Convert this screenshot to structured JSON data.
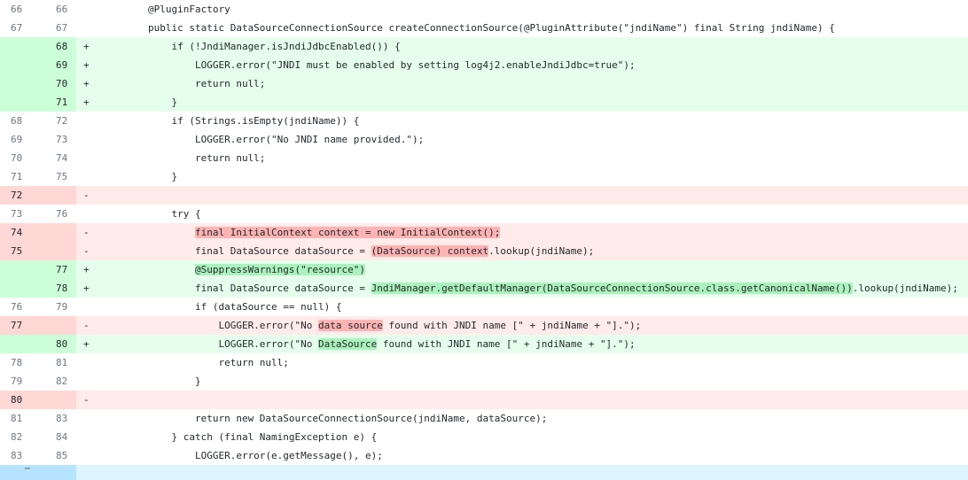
{
  "diff": {
    "rows": [
      {
        "type": "ctx",
        "old": "66",
        "new": "66",
        "sign": "",
        "code": "        @PluginFactory"
      },
      {
        "type": "ctx",
        "old": "67",
        "new": "67",
        "sign": "",
        "code": "        public static DataSourceConnectionSource createConnectionSource(@PluginAttribute(\"jndiName\") final String jndiName) {"
      },
      {
        "type": "add",
        "old": "",
        "new": "68",
        "sign": "+",
        "code": "            if (!JndiManager.isJndiJdbcEnabled()) {"
      },
      {
        "type": "add",
        "old": "",
        "new": "69",
        "sign": "+",
        "code": "                LOGGER.error(\"JNDI must be enabled by setting log4j2.enableJndiJdbc=true\");"
      },
      {
        "type": "add",
        "old": "",
        "new": "70",
        "sign": "+",
        "code": "                return null;"
      },
      {
        "type": "add",
        "old": "",
        "new": "71",
        "sign": "+",
        "code": "            }"
      },
      {
        "type": "ctx",
        "old": "68",
        "new": "72",
        "sign": "",
        "code": "            if (Strings.isEmpty(jndiName)) {"
      },
      {
        "type": "ctx",
        "old": "69",
        "new": "73",
        "sign": "",
        "code": "                LOGGER.error(\"No JNDI name provided.\");"
      },
      {
        "type": "ctx",
        "old": "70",
        "new": "74",
        "sign": "",
        "code": "                return null;"
      },
      {
        "type": "ctx",
        "old": "71",
        "new": "75",
        "sign": "",
        "code": "            }"
      },
      {
        "type": "del",
        "old": "72",
        "new": "",
        "sign": "-",
        "code": ""
      },
      {
        "type": "ctx",
        "old": "73",
        "new": "76",
        "sign": "",
        "code": "            try {"
      },
      {
        "type": "del",
        "old": "74",
        "new": "",
        "sign": "-",
        "code_pre": "                ",
        "hl": "final InitialContext context = new InitialContext();",
        "code_post": ""
      },
      {
        "type": "del",
        "old": "75",
        "new": "",
        "sign": "-",
        "code_pre": "                final DataSource dataSource = ",
        "hl": "(DataSource) context",
        "code_post": ".lookup(jndiName);"
      },
      {
        "type": "add",
        "old": "",
        "new": "77",
        "sign": "+",
        "code_pre": "                ",
        "hl": "@SuppressWarnings(\"resource\")",
        "code_post": ""
      },
      {
        "type": "add",
        "old": "",
        "new": "78",
        "sign": "+",
        "code_pre": "                final DataSource dataSource = ",
        "hl": "JndiManager.getDefaultManager(DataSourceConnectionSource.class.getCanonicalName())",
        "code_post": ".lookup(jndiName);"
      },
      {
        "type": "ctx",
        "old": "76",
        "new": "79",
        "sign": "",
        "code": "                if (dataSource == null) {"
      },
      {
        "type": "del",
        "old": "77",
        "new": "",
        "sign": "-",
        "code_pre": "                    LOGGER.error(\"No ",
        "hl": "data source",
        "code_post": " found with JNDI name [\" + jndiName + \"].\");"
      },
      {
        "type": "add",
        "old": "",
        "new": "80",
        "sign": "+",
        "code_pre": "                    LOGGER.error(\"No ",
        "hl": "DataSource",
        "code_post": " found with JNDI name [\" + jndiName + \"].\");"
      },
      {
        "type": "ctx",
        "old": "78",
        "new": "81",
        "sign": "",
        "code": "                    return null;"
      },
      {
        "type": "ctx",
        "old": "79",
        "new": "82",
        "sign": "",
        "code": "                }"
      },
      {
        "type": "del",
        "old": "80",
        "new": "",
        "sign": "-",
        "code": ""
      },
      {
        "type": "ctx",
        "old": "81",
        "new": "83",
        "sign": "",
        "code": "                return new DataSourceConnectionSource(jndiName, dataSource);"
      },
      {
        "type": "ctx",
        "old": "82",
        "new": "84",
        "sign": "",
        "code": "            } catch (final NamingException e) {"
      },
      {
        "type": "ctx",
        "old": "83",
        "new": "85",
        "sign": "",
        "code": "                LOGGER.error(e.getMessage(), e);"
      }
    ],
    "expand_icon": "expand-down-icon",
    "expand_glyph": "⋯",
    "colors": {
      "add_bg": "#e6ffec",
      "add_num": "#ccffd8",
      "add_hl": "#abf2bc",
      "del_bg": "#ffebe9",
      "del_num": "#ffd7d5",
      "del_hl": "#ffb3b3",
      "expand_bg": "#ddf4ff"
    }
  }
}
